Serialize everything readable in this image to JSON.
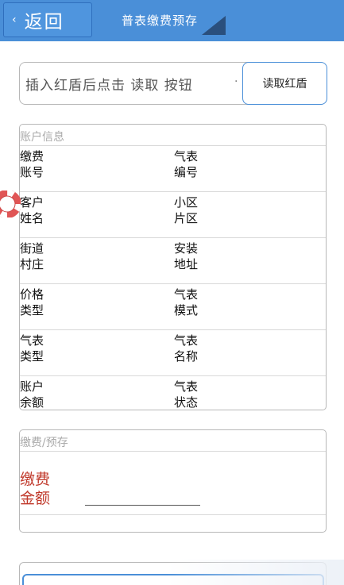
{
  "header": {
    "back_label": "返回",
    "back_chevron": "‹",
    "title": "普表缴费预存",
    "accent_color": "#4a8fd8"
  },
  "reader": {
    "hint": "插入红盾后点击 读取 按钮",
    "dot": "·",
    "button_label": "读取红盾"
  },
  "account": {
    "header": "账户信息",
    "rows": [
      {
        "left": "缴费\n账号",
        "right": "气表\n编号"
      },
      {
        "left": "客户\n姓名",
        "right": "小区\n片区"
      },
      {
        "left": "街道\n村庄",
        "right": "安装\n地址"
      },
      {
        "left": "价格\n类型",
        "right": "气表\n模式"
      },
      {
        "left": "气表\n类型",
        "right": "气表\n名称"
      },
      {
        "left": "账户\n余额",
        "right": "气表\n状态"
      }
    ]
  },
  "payment": {
    "header": "缴费/预存",
    "amount_label": "缴费\n金额",
    "amount_label_color": "#c0392b",
    "amount_value": ""
  },
  "icons": {
    "float_ring": "lifebuoy-icon",
    "title_corner": "corner-triangle-icon"
  }
}
